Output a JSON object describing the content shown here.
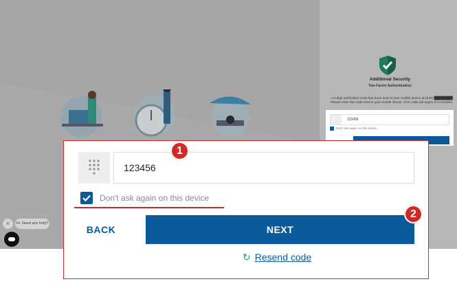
{
  "background": {
    "security_title": "Additional Security",
    "security_subtitle": "Two Factor Authentication",
    "security_text": "A 6 digit verification code has been sent to your mobile device at (949) ████████ Please enter the code sent to your mobile device. This code will expire in 5 minutes.",
    "mini_code_value": "123456",
    "mini_checkbox_label": "Don't ask again on this device"
  },
  "chat": {
    "close_glyph": "×",
    "bubble_text": "Hi. Need any help?"
  },
  "form": {
    "code_value": "123456",
    "remember_checked": true,
    "remember_label": "Don't ask again on this device",
    "back_label": "BACK",
    "next_label": "NEXT",
    "resend_icon": "refresh-icon",
    "resend_label": "Resend code"
  },
  "markers": {
    "step1": "1",
    "step2": "2"
  },
  "colors": {
    "brand_blue": "#0a5a9c",
    "highlight_red": "#d0292a",
    "resend_icon_green": "#1c9c6a"
  }
}
